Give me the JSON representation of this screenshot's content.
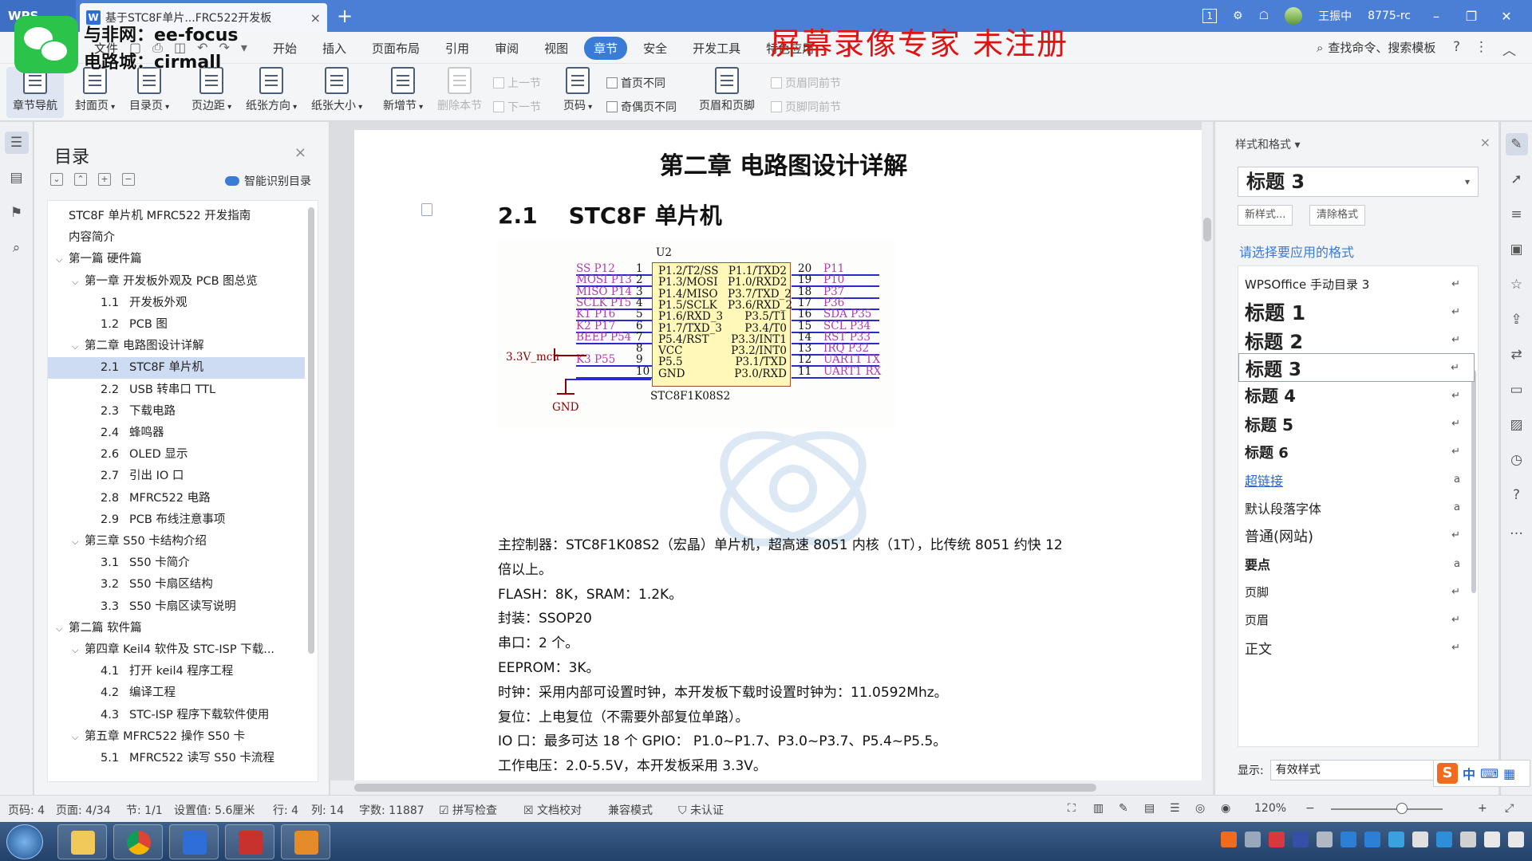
{
  "titlebar": {
    "app_tab": "WPS",
    "doc_tab_title": "基于STC8F单片...FRC522开发板",
    "right_badge": "1",
    "user_name": "王振中",
    "user_id": "8775-rc"
  },
  "watermarks": {
    "ee_line1": "与非网：ee-focus",
    "ee_line2": "电路城：cirmall",
    "recorder": "屏幕录像专家 未注册"
  },
  "menubar": {
    "file_label": "文件",
    "items": [
      "开始",
      "插入",
      "页面布局",
      "引用",
      "审阅",
      "视图",
      "章节",
      "安全",
      "开发工具",
      "特色应用"
    ],
    "active_item": "章节",
    "search_label": "查找命令、搜索模板"
  },
  "ribbon": {
    "chapter_nav": "章节导航",
    "cover_page": "封面页",
    "toc_page": "目录页",
    "margins": "页边距",
    "orientation": "纸张方向",
    "paper_size": "纸张大小",
    "new_section": "新增节",
    "delete_section": "删除本节",
    "prev_section": "上一节",
    "next_section": "下一节",
    "page_number": "页码",
    "first_page_diff": "首页不同",
    "odd_even_diff": "奇偶页不同",
    "header_footer": "页眉和页脚",
    "header_same": "页眉同前节",
    "footer_same": "页脚同前节"
  },
  "toc": {
    "title": "目录",
    "smart_detect": "智能识别目录",
    "items": [
      {
        "level": 1,
        "num": "",
        "text": "STC8F 单片机 MFRC522 开发指南",
        "arrow": ""
      },
      {
        "level": 1,
        "num": "",
        "text": "内容简介",
        "arrow": ""
      },
      {
        "level": 1,
        "num": "",
        "text": "第一篇 硬件篇",
        "arrow": "v"
      },
      {
        "level": 2,
        "num": "",
        "text": "第一章 开发板外观及 PCB 图总览",
        "arrow": "v"
      },
      {
        "level": 3,
        "num": "1.1",
        "text": "开发板外观",
        "arrow": ""
      },
      {
        "level": 3,
        "num": "1.2",
        "text": "PCB 图",
        "arrow": ""
      },
      {
        "level": 2,
        "num": "",
        "text": "第二章 电路图设计详解",
        "arrow": "v"
      },
      {
        "level": 3,
        "num": "2.1",
        "text": "STC8F 单片机",
        "arrow": "",
        "selected": true
      },
      {
        "level": 3,
        "num": "2.2",
        "text": "USB 转串口 TTL",
        "arrow": ""
      },
      {
        "level": 3,
        "num": "2.3",
        "text": "下载电路",
        "arrow": ""
      },
      {
        "level": 3,
        "num": "2.4",
        "text": "蜂鸣器",
        "arrow": ""
      },
      {
        "level": 3,
        "num": "2.6",
        "text": "OLED 显示",
        "arrow": ""
      },
      {
        "level": 3,
        "num": "2.7",
        "text": "引出 IO 口",
        "arrow": ""
      },
      {
        "level": 3,
        "num": "2.8",
        "text": "MFRC522 电路",
        "arrow": ""
      },
      {
        "level": 3,
        "num": "2.9",
        "text": "PCB 布线注意事项",
        "arrow": ""
      },
      {
        "level": 2,
        "num": "",
        "text": "第三章 S50 卡结构介绍",
        "arrow": "v"
      },
      {
        "level": 3,
        "num": "3.1",
        "text": "S50 卡简介",
        "arrow": ""
      },
      {
        "level": 3,
        "num": "3.2",
        "text": "S50 卡扇区结构",
        "arrow": ""
      },
      {
        "level": 3,
        "num": "3.3",
        "text": "S50 卡扇区读写说明",
        "arrow": ""
      },
      {
        "level": 1,
        "num": "",
        "text": "第二篇 软件篇",
        "arrow": "v"
      },
      {
        "level": 2,
        "num": "",
        "text": "第四章 Keil4 软件及 STC-ISP 下载...",
        "arrow": "v"
      },
      {
        "level": 3,
        "num": "4.1",
        "text": "打开 keil4 程序工程",
        "arrow": ""
      },
      {
        "level": 3,
        "num": "4.2",
        "text": "编译工程",
        "arrow": ""
      },
      {
        "level": 3,
        "num": "4.3",
        "text": "STC-ISP 程序下载软件使用",
        "arrow": ""
      },
      {
        "level": 2,
        "num": "",
        "text": "第五章 MFRC522 操作 S50 卡",
        "arrow": "v"
      },
      {
        "level": 3,
        "num": "5.1",
        "text": "MFRC522 读写 S50 卡流程",
        "arrow": ""
      }
    ]
  },
  "doc": {
    "chapter_title": "第二章 电路图设计详解",
    "section_num": "2.1",
    "section_title": "STC8F 单片机",
    "schematic": {
      "ref": "U2",
      "part": "STC8F1K08S2",
      "left_pins": [
        {
          "num": "1",
          "name": "P1.2/T2/SS",
          "net": "SS P12"
        },
        {
          "num": "2",
          "name": "P1.3/MOSI",
          "net": "MOSI P13"
        },
        {
          "num": "3",
          "name": "P1.4/MISO",
          "net": "MISO P14"
        },
        {
          "num": "4",
          "name": "P1.5/SCLK",
          "net": "SCLK P15"
        },
        {
          "num": "5",
          "name": "P1.6/RXD_3",
          "net": "K1 P16"
        },
        {
          "num": "6",
          "name": "P1.7/TXD_3",
          "net": "K2 P17"
        },
        {
          "num": "7",
          "name": "P5.4/RST",
          "net": "BEEP P54"
        },
        {
          "num": "8",
          "name": "VCC",
          "net": ""
        },
        {
          "num": "9",
          "name": "P5.5",
          "net": "K3 P55"
        },
        {
          "num": "10",
          "name": "GND",
          "net": ""
        }
      ],
      "right_pins": [
        {
          "num": "20",
          "name": "P1.1/TXD2",
          "net": "P11"
        },
        {
          "num": "19",
          "name": "P1.0/RXD2",
          "net": "P10"
        },
        {
          "num": "18",
          "name": "P3.7/TXD_2",
          "net": "P37"
        },
        {
          "num": "17",
          "name": "P3.6/RXD_2",
          "net": "P36"
        },
        {
          "num": "16",
          "name": "P3.5/T1",
          "net": "SDA P35"
        },
        {
          "num": "15",
          "name": "P3.4/T0",
          "net": "SCL P34"
        },
        {
          "num": "14",
          "name": "P3.3/INT1",
          "net": "RST P33"
        },
        {
          "num": "13",
          "name": "P3.2/INT0",
          "net": "IRQ P32"
        },
        {
          "num": "12",
          "name": "P3.1/TXD",
          "net": "UART1 TX"
        },
        {
          "num": "11",
          "name": "P3.0/RXD",
          "net": "UART1 RX"
        }
      ],
      "vcc_label": "3.3V_mcu",
      "gnd_label": "GND"
    },
    "body_lines": [
      "主控制器：STC8F1K08S2（宏晶）单片机，超高速 8051 内核（1T），比传统 8051 约快 12",
      "倍以上。",
      "FLASH：8K，SRAM：1.2K。",
      "封装：SSOP20",
      "串口：2 个。",
      "EEPROM：3K。",
      "时钟：采用内部可设置时钟，本开发板下载时设置时钟为：11.0592Mhz。",
      "复位：上电复位（不需要外部复位单路）。",
      "IO 口：最多可达 18 个 GPIO： P1.0~P1.7、P3.0~P3.7、P5.4~P5.5。",
      "工作电压：2.0-5.5V，本开发板采用 3.3V。"
    ]
  },
  "styles_panel": {
    "title": "样式和格式",
    "current_style": "标题 3",
    "new_style": "新样式...",
    "clear_format": "清除格式",
    "hint": "请选择要应用的格式",
    "styles": [
      {
        "name": "WPSOffice 手动目录 3",
        "mark": "↵",
        "size": 15,
        "bold": false,
        "link": false
      },
      {
        "name": "标题 1",
        "mark": "↵",
        "size": 25,
        "bold": true,
        "link": false
      },
      {
        "name": "标题 2",
        "mark": "↵",
        "size": 24,
        "bold": true,
        "link": false
      },
      {
        "name": "标题 3",
        "mark": "↵",
        "size": 23,
        "bold": true,
        "link": false,
        "selected": true
      },
      {
        "name": "标题 4",
        "mark": "↵",
        "size": 21,
        "bold": true,
        "link": false
      },
      {
        "name": "标题 5",
        "mark": "↵",
        "size": 20,
        "bold": true,
        "link": false
      },
      {
        "name": "标题 6",
        "mark": "↵",
        "size": 18,
        "bold": true,
        "link": false
      },
      {
        "name": "超链接",
        "mark": "a",
        "size": 16,
        "bold": false,
        "link": true
      },
      {
        "name": "默认段落字体",
        "mark": "a",
        "size": 16,
        "bold": false,
        "link": false
      },
      {
        "name": "普通(网站)",
        "mark": "↵",
        "size": 18,
        "bold": false,
        "link": false
      },
      {
        "name": "要点",
        "mark": "a",
        "size": 16,
        "bold": true,
        "link": false
      },
      {
        "name": "页脚",
        "mark": "↵",
        "size": 15,
        "bold": false,
        "link": false
      },
      {
        "name": "页眉",
        "mark": "↵",
        "size": 15,
        "bold": false,
        "link": false
      },
      {
        "name": "正文",
        "mark": "↵",
        "size": 17,
        "bold": false,
        "link": false
      }
    ],
    "show_label": "显示:",
    "show_value": "有效样式"
  },
  "statusbar": {
    "page_num": "页码: 4",
    "page_of": "页面: 4/34",
    "section": "节: 1/1",
    "setting": "设置值: 5.6厘米",
    "row": "行: 4",
    "col": "列: 14",
    "words": "字数: 11887",
    "spell": "拼写检查",
    "proof": "文档校对",
    "compat": "兼容模式",
    "uncert": "未认证",
    "zoom": "120%"
  },
  "ime": {
    "mode": "中"
  },
  "colors": {
    "accent": "#3a7bd5",
    "titlebar": "#4b7fd6",
    "watermark": "#e01212",
    "net": "#b03cb0",
    "chip": "#fff8b8"
  }
}
